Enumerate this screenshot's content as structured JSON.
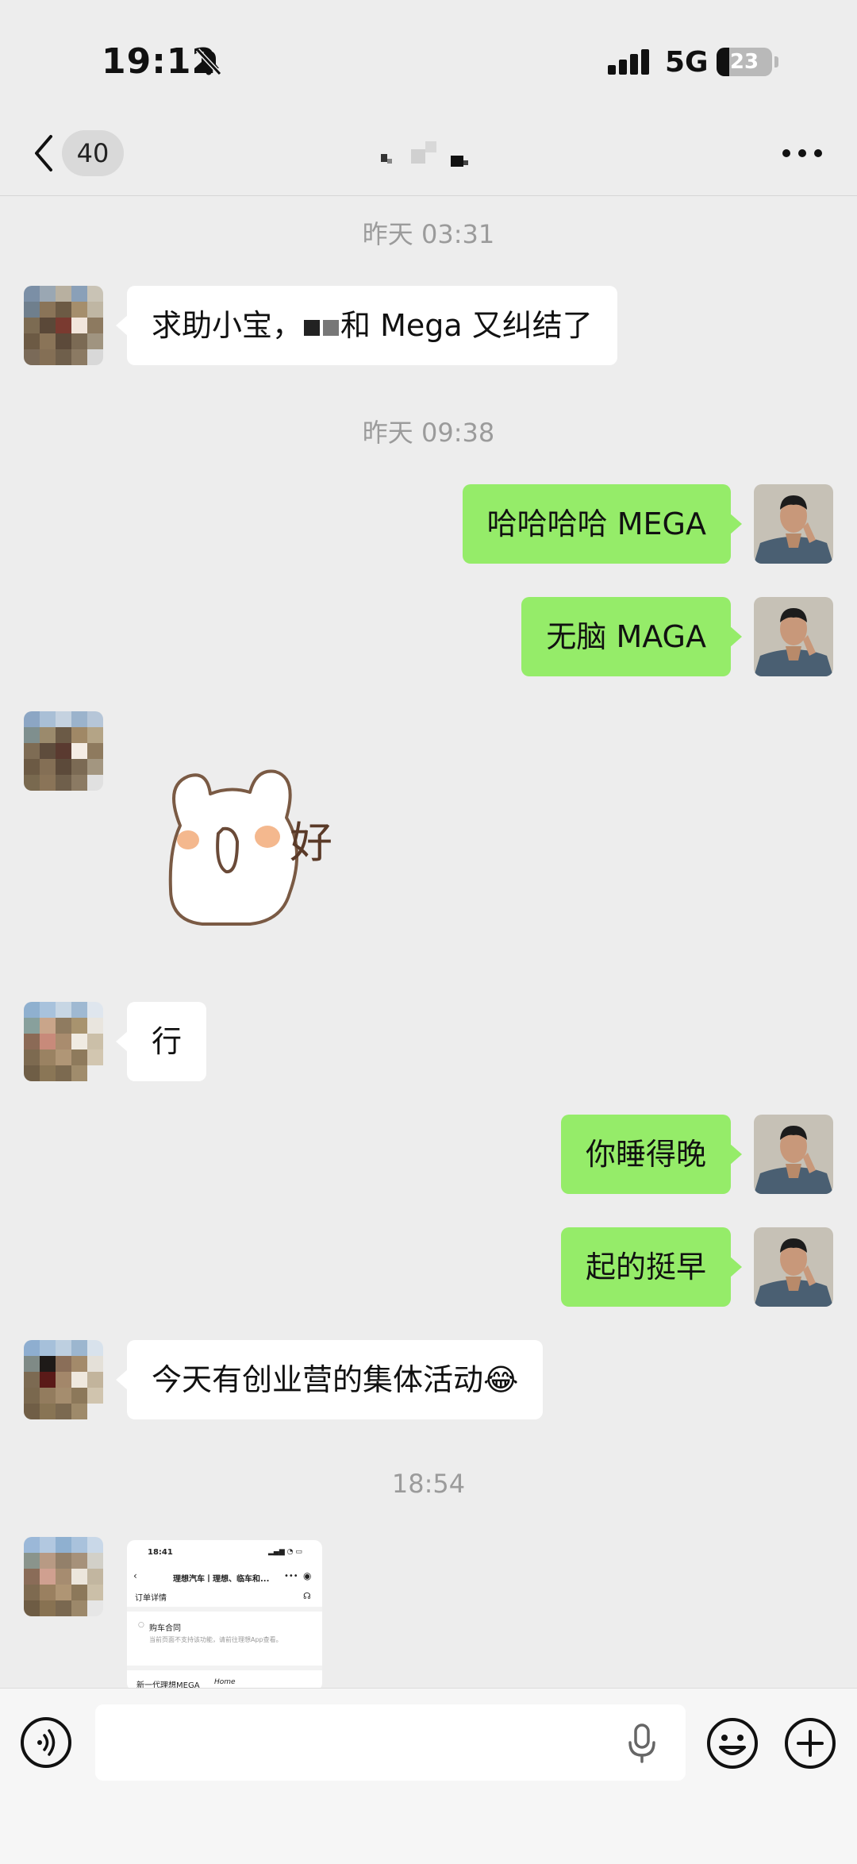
{
  "status_bar": {
    "time": "19:12",
    "network": "5G",
    "battery": "23",
    "battery_level": 0.23
  },
  "nav": {
    "unread_count": "40",
    "back_icon": "chevron-left-icon",
    "more_icon": "more-dots-icon"
  },
  "messages": [
    {
      "type": "timestamp",
      "text": "昨天 03:31"
    },
    {
      "type": "incoming",
      "text_before": "求助小宝，",
      "text_after": "和 Mega 又纠结了"
    },
    {
      "type": "timestamp",
      "text": "昨天 09:38"
    },
    {
      "type": "outgoing",
      "text": "哈哈哈哈 MEGA"
    },
    {
      "type": "outgoing",
      "text": "无脑 MAGA"
    },
    {
      "type": "incoming-sticker",
      "sticker_text": "好"
    },
    {
      "type": "incoming",
      "text": "行"
    },
    {
      "type": "outgoing",
      "text": "你睡得晚"
    },
    {
      "type": "outgoing",
      "text": "起的挺早"
    },
    {
      "type": "incoming",
      "text": "今天有创业营的集体活动😂"
    },
    {
      "type": "timestamp",
      "text": "18:54"
    },
    {
      "type": "incoming-image",
      "image": {
        "time": "18:41",
        "title": "理想汽车丨理想、临车和...",
        "section": "订单详情",
        "item": "购车合同",
        "note": "当前页面不支持该功能，请前往理想App查看。",
        "footer": "新一代理想MEGA",
        "footer_badge": "Home"
      }
    }
  ],
  "input_bar": {
    "placeholder": "",
    "icons": [
      "voice-icon",
      "microphone-icon",
      "emoji-icon",
      "plus-icon"
    ]
  },
  "colors": {
    "background": "#ededed",
    "outgoing_bubble": "#95ec69",
    "incoming_bubble": "#ffffff",
    "timestamp": "#9b9b9b"
  }
}
